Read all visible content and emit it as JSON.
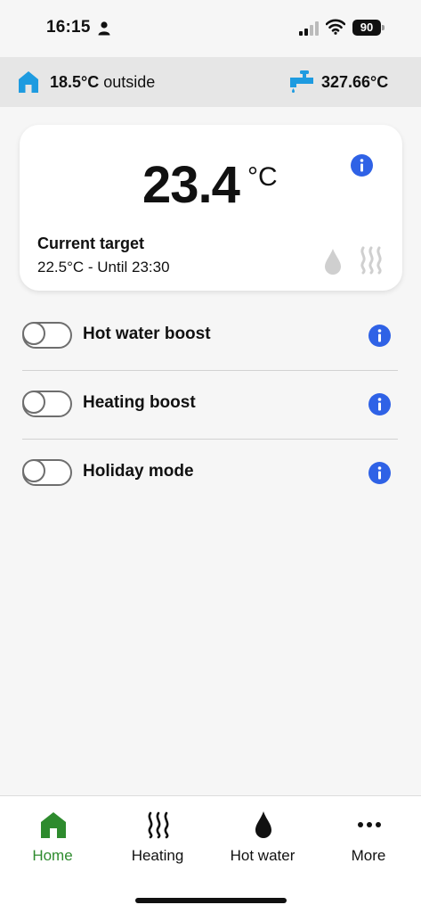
{
  "status_bar": {
    "time": "16:15",
    "battery": "90"
  },
  "info_bar": {
    "outside_temp": "18.5°C",
    "outside_label": "outside",
    "water_temp": "327.66°C"
  },
  "card": {
    "current_temp": "23.4",
    "unit": "°C",
    "target_label": "Current target",
    "target_value": "22.5°C - Until 23:30"
  },
  "toggles": [
    {
      "label": "Hot water boost",
      "enabled": false
    },
    {
      "label": "Heating boost",
      "enabled": false
    },
    {
      "label": "Holiday mode",
      "enabled": false
    }
  ],
  "nav": [
    {
      "label": "Home",
      "icon": "home-icon",
      "active": true
    },
    {
      "label": "Heating",
      "icon": "heating-icon",
      "active": false
    },
    {
      "label": "Hot water",
      "icon": "water-drop-icon",
      "active": false
    },
    {
      "label": "More",
      "icon": "more-icon",
      "active": false
    }
  ],
  "colors": {
    "accent_blue": "#2f62e6",
    "icon_blue": "#1e9be0",
    "active_green": "#2e8b2e"
  }
}
